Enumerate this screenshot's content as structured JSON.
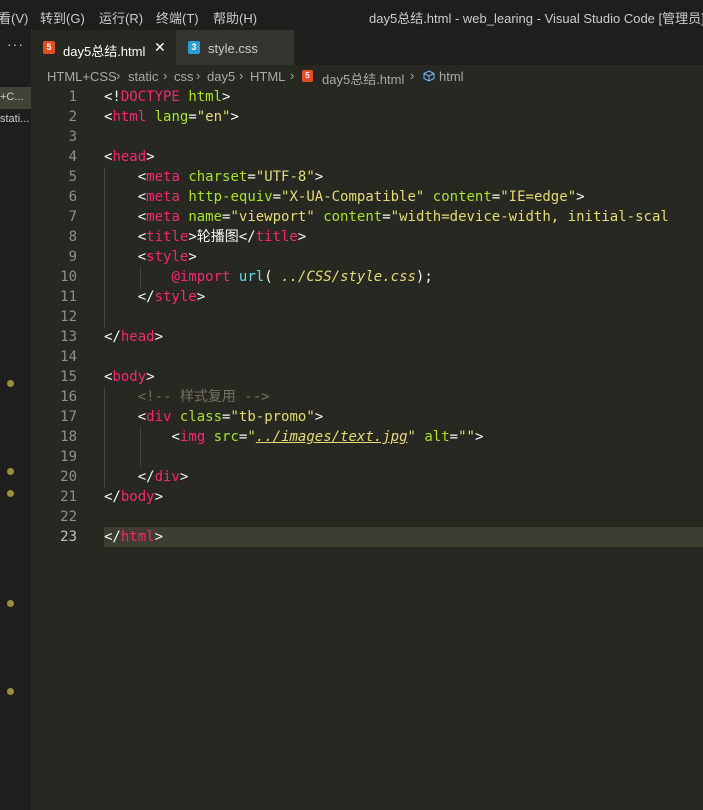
{
  "titlebar": {
    "menu": [
      "看(V)",
      "转到(G)",
      "运行(R)",
      "终端(T)",
      "帮助(H)"
    ],
    "title": "day5总结.html - web_learing - Visual Studio Code [管理员]"
  },
  "sidebar": {
    "dots": "···",
    "items": [
      "+C...",
      "stati..."
    ]
  },
  "tabs": [
    {
      "label": "day5总结.html",
      "icon": "html5-icon",
      "active": true,
      "close": "✕"
    },
    {
      "label": "style.css",
      "icon": "css3-icon",
      "active": false
    }
  ],
  "breadcrumb": [
    "HTML+CSS",
    "static",
    "css",
    "day5",
    "HTML",
    "day5总结.html",
    "html"
  ],
  "editor": {
    "line_numbers": [
      "1",
      "2",
      "3",
      "4",
      "5",
      "6",
      "7",
      "8",
      "9",
      "10",
      "11",
      "12",
      "13",
      "14",
      "15",
      "16",
      "17",
      "18",
      "19",
      "20",
      "21",
      "22",
      "23"
    ],
    "current_line": 23
  },
  "colors": {
    "background": "#272822",
    "tag": "#f92672",
    "attribute": "#a6e22e",
    "string": "#e6db74",
    "comment": "#75715e",
    "function": "#66d9ef"
  }
}
